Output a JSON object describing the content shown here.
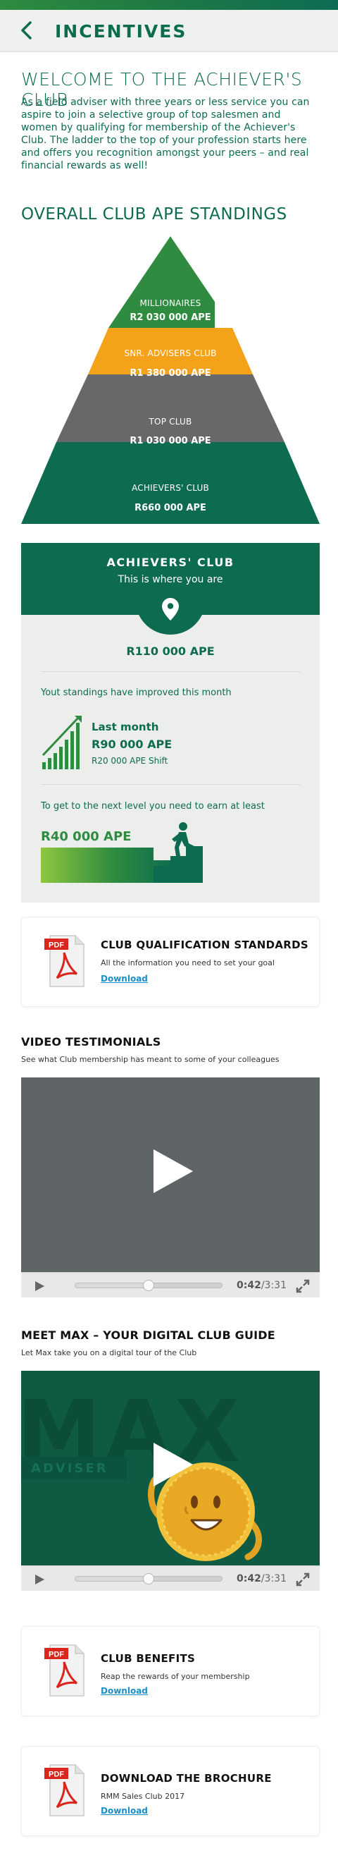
{
  "header": {
    "title": "INCENTIVES"
  },
  "welcome": {
    "title": "WELCOME TO THE ACHIEVER'S CLUB",
    "text": "As a field adviser with three years or less service you can aspire to join a selective group of top salesmen and women by qualifying for membership of the Achiever's Club. The ladder to the top of your profession starts here and offers you recognition amongst your peers – and real financial rewards as well!"
  },
  "standings": {
    "title": "OVERALL CLUB APE STANDINGS",
    "tiers": [
      {
        "label": "MILLIONAIRES",
        "value": "R2 030 000 APE",
        "color": "#2e8b3f"
      },
      {
        "label": "SNR. ADVISERS CLUB",
        "value": "R1 380 000 APE",
        "color": "#f5a21b"
      },
      {
        "label": "TOP CLUB",
        "value": "R1 030 000 APE",
        "color": "#676869"
      },
      {
        "label": "ACHIEVERS' CLUB",
        "value": "R660 000 APE",
        "color": "#0d6b50"
      }
    ]
  },
  "achiever": {
    "title": "ACHIEVERS' CLUB",
    "subtitle": "This is where you are",
    "value": "R110 000 APE",
    "improved": "Yout standings have improved this month",
    "last_month_label": "Last month",
    "last_month_value": "R90 000 APE",
    "shift": "R20 000 APE Shift",
    "next_label": "To get to the next level you need to earn at least",
    "next_value": "R40 000 APE"
  },
  "qualification": {
    "icon_text": "PDF",
    "title": "CLUB QUALIFICATION STANDARDS",
    "subtitle": "All the information you need to set your goal",
    "link": "Download"
  },
  "testimonials": {
    "title": "VIDEO TESTIMONIALS",
    "subtitle": "See what Club membership has meant to some of your colleagues",
    "current_time": "0:42",
    "total_time": "/3:31",
    "progress": 0.5
  },
  "max": {
    "title": "MEET MAX – YOUR DIGITAL CLUB GUIDE",
    "subtitle": "Let Max take you on a digital tour of the Club",
    "bg_text": "MAX",
    "bg_sub": "ADVISER",
    "current_time": "0:42",
    "total_time": "/3:31",
    "progress": 0.5
  },
  "benefits": {
    "icon_text": "PDF",
    "title": "CLUB BENEFITS",
    "subtitle": "Reap the rewards of your membership",
    "link": "Download"
  },
  "brochure": {
    "icon_text": "PDF",
    "title": "DOWNLOAD THE BROCHURE",
    "subtitle": "RMM Sales Club 2017",
    "link": "Download"
  }
}
